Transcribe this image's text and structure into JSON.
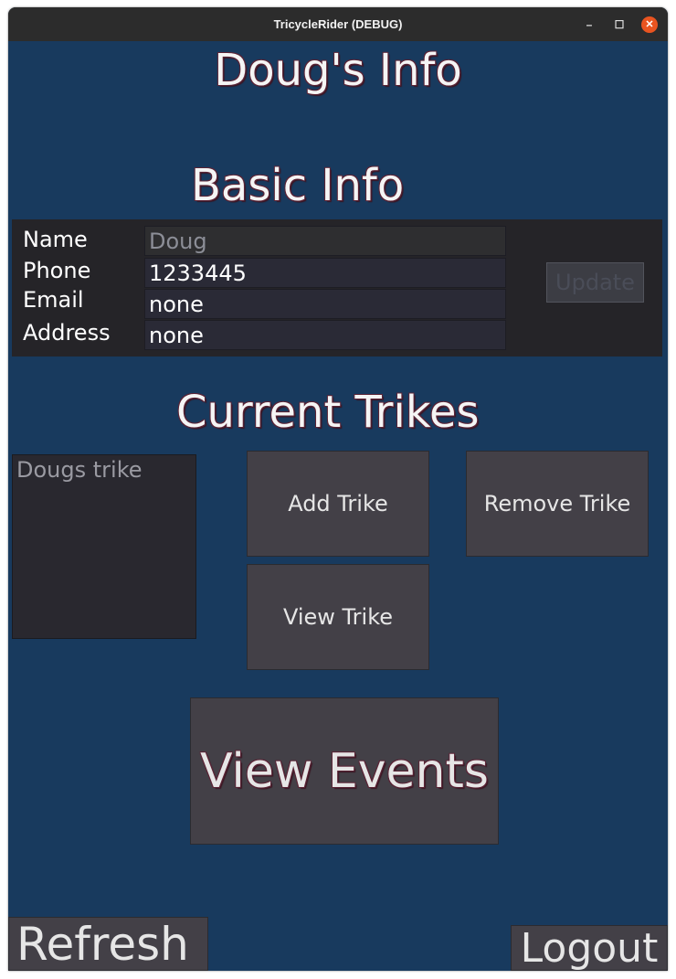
{
  "window": {
    "title": "TricycleRider (DEBUG)",
    "controls": {
      "minimize": "–",
      "maximize": "☐",
      "close": "✕"
    },
    "close_color": "#e95420"
  },
  "page": {
    "title": "Doug's  Info",
    "basic_heading": "Basic Info",
    "trikes_heading": "Current Trikes"
  },
  "basic_info": {
    "name_label": "Name",
    "name_value": "Doug",
    "phone_label": "Phone",
    "phone_value": "1233445",
    "email_label": "Email",
    "email_value": "none",
    "address_label": "Address",
    "address_value": "none",
    "update_label": "Update"
  },
  "trikes": {
    "items": [
      "Dougs trike"
    ],
    "add_label": "Add Trike",
    "remove_label": "Remove Trike",
    "view_label": "View Trike"
  },
  "actions": {
    "events_label": "View Events",
    "refresh_label": "Refresh",
    "logout_label": "Logout"
  },
  "colors": {
    "background": "#183a5e",
    "panel": "#252428",
    "button": "#434047"
  }
}
